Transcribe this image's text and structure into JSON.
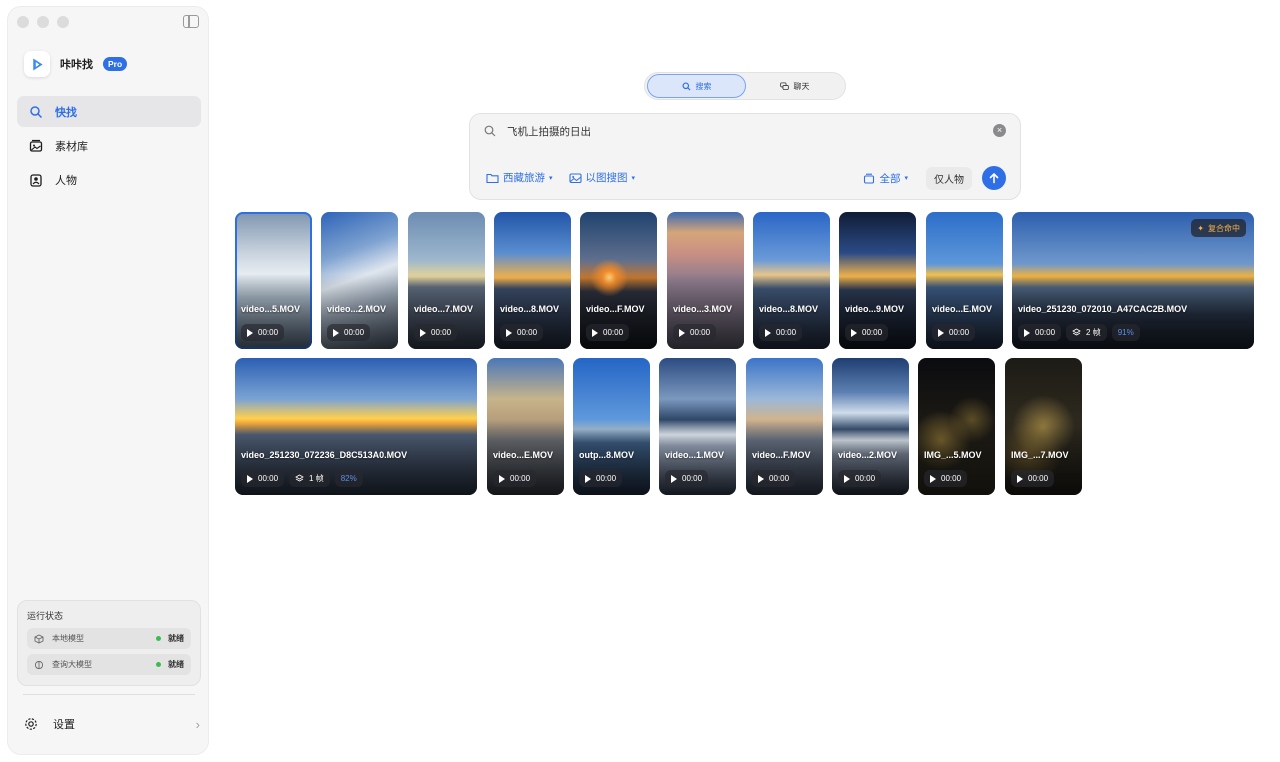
{
  "app": {
    "name": "咔咔找",
    "badge": "Pro"
  },
  "sidebar": {
    "items": [
      {
        "label": "快找",
        "icon": "search-icon",
        "active": true
      },
      {
        "label": "素材库",
        "icon": "photo-library-icon",
        "active": false
      },
      {
        "label": "人物",
        "icon": "person-icon",
        "active": false
      }
    ],
    "status": {
      "title": "运行状态",
      "rows": [
        {
          "label": "本地模型",
          "state": "就绪",
          "icon": "cube-icon"
        },
        {
          "label": "查询大模型",
          "state": "就绪",
          "icon": "brain-icon"
        }
      ]
    },
    "settings_label": "设置"
  },
  "mode": {
    "search_label": "搜索",
    "chat_label": "聊天",
    "active": "search"
  },
  "search": {
    "query": "飞机上拍摄的日出",
    "filters": [
      {
        "label": "西藏旅游",
        "icon": "folder-icon"
      },
      {
        "label": "以图搜图",
        "icon": "image-icon"
      }
    ],
    "scope_label": "全部",
    "people_only_label": "仅人物"
  },
  "results": {
    "row1": [
      {
        "name": "video...5.MOV",
        "duration": "00:00",
        "selected": true
      },
      {
        "name": "video...2.MOV",
        "duration": "00:00"
      },
      {
        "name": "video...7.MOV",
        "duration": "00:00"
      },
      {
        "name": "video...8.MOV",
        "duration": "00:00"
      },
      {
        "name": "video...F.MOV",
        "duration": "00:00"
      },
      {
        "name": "video...3.MOV",
        "duration": "00:00"
      },
      {
        "name": "video...8.MOV",
        "duration": "00:00"
      },
      {
        "name": "video...9.MOV",
        "duration": "00:00"
      },
      {
        "name": "video...E.MOV",
        "duration": "00:00"
      },
      {
        "name": "video_251230_072010_A47CAC2B.MOV",
        "duration": "00:00",
        "frames": "2 帧",
        "score": "91%",
        "hit_badge": "复合命中"
      }
    ],
    "row2": [
      {
        "name": "video_251230_072236_D8C513A0.MOV",
        "duration": "00:00",
        "frames": "1 帧",
        "score": "82%"
      },
      {
        "name": "video...E.MOV",
        "duration": "00:00"
      },
      {
        "name": "outp...8.MOV",
        "duration": "00:00"
      },
      {
        "name": "video...1.MOV",
        "duration": "00:00"
      },
      {
        "name": "video...F.MOV",
        "duration": "00:00"
      },
      {
        "name": "video...2.MOV",
        "duration": "00:00"
      },
      {
        "name": "IMG_...5.MOV",
        "duration": "00:00"
      },
      {
        "name": "IMG_...7.MOV",
        "duration": "00:00"
      }
    ]
  },
  "colors": {
    "accent": "#2f6fe6",
    "status_ok": "#3dbb4f",
    "sidebar_bg": "#f6f6f6"
  }
}
